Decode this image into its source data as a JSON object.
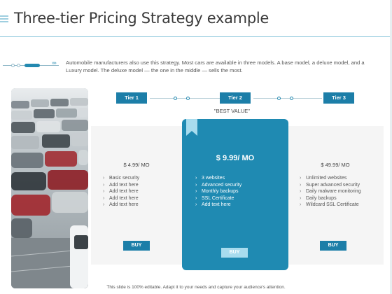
{
  "slide": {
    "title": "Three-tier Pricing Strategy example",
    "intro": "Automobile manufacturers also use this strategy. Most cars are available in three models. A base model, a deluxe model, and a Luxury model. The deluxe model — the one in the middle — sells the most.",
    "footer": "This slide is 100% editable. Adapt it to your needs and capture your audience's attention.",
    "arrows": "»»"
  },
  "tiers": [
    {
      "label": "Tier 1",
      "price": "$ 4.99/ MO",
      "features": [
        "Basic security",
        "Add text here",
        "Add text here",
        "Add text here",
        "Add text here"
      ],
      "buy_label": "BUY"
    },
    {
      "label": "Tier 2",
      "price": "$ 9.99/ MO",
      "features": [
        "3 websites",
        "Advanced security",
        "Monthly backups",
        "SSL Certificate",
        "Add text here"
      ],
      "buy_label": "BUY"
    },
    {
      "label": "Tier 3",
      "price": "$ 49.99/ MO",
      "features": [
        "Unlimited websites",
        "Super advanced security",
        "Daily malware monitoring",
        "Daily backups",
        "Wildcard SSL Certificate"
      ],
      "buy_label": "BUY"
    }
  ],
  "best_value": "\"BEST VALUE\"",
  "colors": {
    "accent": "#1c7ea8",
    "highlight_card": "#1f8ab2",
    "card_bg": "#f5f5f5"
  },
  "icons": {
    "ribbon": "bookmark-ribbon-icon",
    "photo": "parking-lot-cars-image"
  }
}
